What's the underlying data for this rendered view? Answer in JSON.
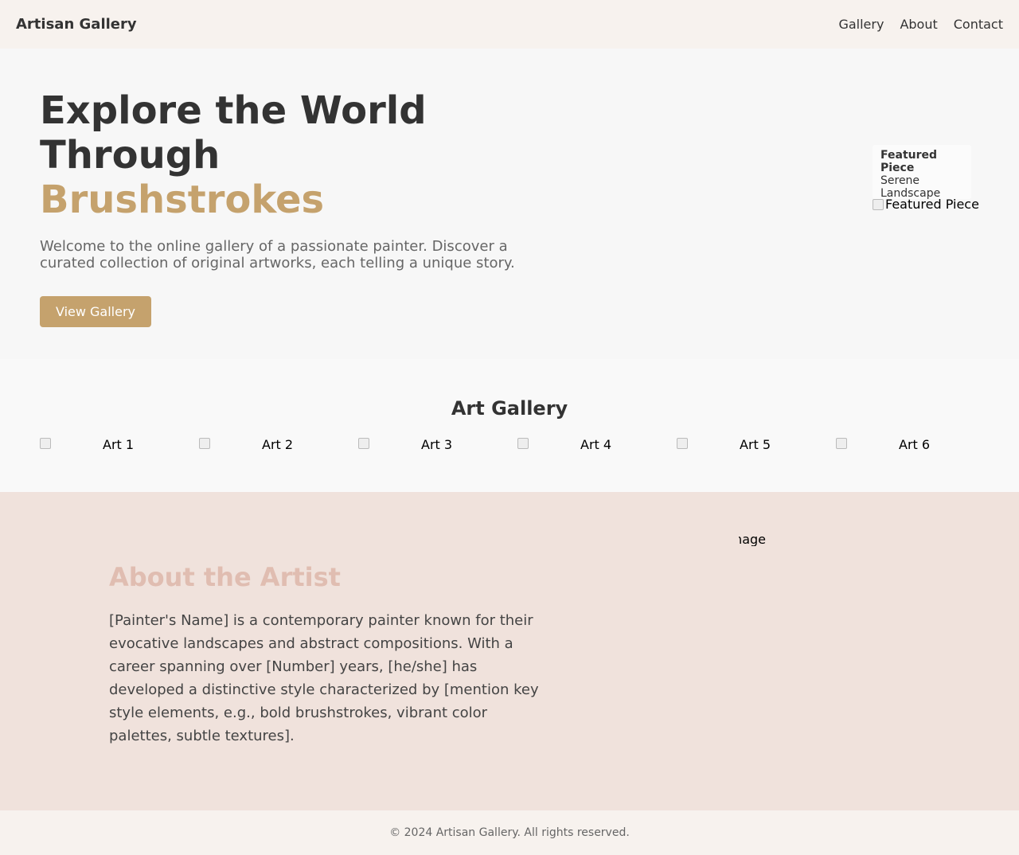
{
  "header": {
    "logo": "Artisan Gallery",
    "nav": [
      "Gallery",
      "About",
      "Contact"
    ]
  },
  "hero": {
    "title_line1": "Explore the World",
    "title_line2": "Through",
    "title_accent": "Brushstrokes",
    "description": "Welcome to the online gallery of a passionate painter. Discover a curated collection of original artworks, each telling a unique story.",
    "button_label": "View Gallery",
    "featured": {
      "title": "Featured Piece",
      "subtitle": "Serene Landscape",
      "image_alt": "Featured Piece"
    }
  },
  "gallery": {
    "title": "Art Gallery",
    "items": [
      "Art 1",
      "Art 2",
      "Art 3",
      "Art 4",
      "Art 5",
      "Art 6"
    ]
  },
  "about": {
    "title": "About the Artist",
    "text": "[Painter's Name] is a contemporary painter known for their evocative landscapes and abstract compositions. With a career spanning over [Number] years, [he/she] has developed a distinctive style characterized by [mention key style elements, e.g., bold brushstrokes, vibrant color palettes, subtle textures].",
    "image_alt": "Artist Image"
  },
  "footer": {
    "text": "© 2024 Artisan Gallery. All rights reserved."
  },
  "colors": {
    "accent": "#c5a26d",
    "about_title": "#e0bdb1",
    "about_bg": "#f0e2dc",
    "header_bg": "#f7f2ee"
  }
}
